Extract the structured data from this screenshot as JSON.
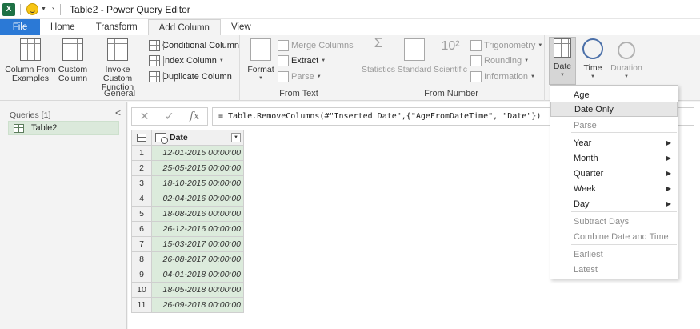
{
  "window": {
    "title": "Table2 - Power Query Editor",
    "app_logo": "X"
  },
  "tabs": [
    {
      "label": "File",
      "name": "tab-file"
    },
    {
      "label": "Home",
      "name": "tab-home"
    },
    {
      "label": "Transform",
      "name": "tab-transform"
    },
    {
      "label": "Add Column",
      "name": "tab-add-column"
    },
    {
      "label": "View",
      "name": "tab-view"
    }
  ],
  "ribbon": {
    "general": {
      "label": "General",
      "column_from_examples": "Column From Examples",
      "custom_column": "Custom Column",
      "invoke_custom_function": "Invoke Custom Function",
      "conditional_column": "Conditional Column",
      "index_column": "Index Column",
      "duplicate_column": "Duplicate Column"
    },
    "from_text": {
      "label": "From Text",
      "format": "Format",
      "merge_columns": "Merge Columns",
      "extract": "Extract",
      "parse": "Parse"
    },
    "from_number": {
      "label": "From Number",
      "statistics": "Statistics",
      "standard": "Standard",
      "scientific": "Scientific",
      "trigonometry": "Trigonometry",
      "rounding": "Rounding",
      "information": "Information"
    },
    "date_time": {
      "date": "Date",
      "time": "Time",
      "duration": "Duration"
    }
  },
  "queries": {
    "header": "Queries [1]",
    "items": [
      {
        "label": "Table2"
      }
    ]
  },
  "formula_bar": {
    "formula": "= Table.RemoveColumns(#\"Inserted Date\",{\"AgeFromDateTime\", \"Date\"})",
    "fx": "fx"
  },
  "table": {
    "column": "Date",
    "rows": [
      {
        "n": "1",
        "value": "12-01-2015 00:00:00"
      },
      {
        "n": "2",
        "value": "25-05-2015 00:00:00"
      },
      {
        "n": "3",
        "value": "18-10-2015 00:00:00"
      },
      {
        "n": "4",
        "value": "02-04-2016 00:00:00"
      },
      {
        "n": "5",
        "value": "18-08-2016 00:00:00"
      },
      {
        "n": "6",
        "value": "26-12-2016 00:00:00"
      },
      {
        "n": "7",
        "value": "15-03-2017 00:00:00"
      },
      {
        "n": "8",
        "value": "26-08-2017 00:00:00"
      },
      {
        "n": "9",
        "value": "04-01-2018 00:00:00"
      },
      {
        "n": "10",
        "value": "18-05-2018 00:00:00"
      },
      {
        "n": "11",
        "value": "26-09-2018 00:00:00"
      }
    ]
  },
  "date_menu": {
    "items": [
      {
        "label": "Age",
        "enabled": true,
        "submenu": false
      },
      {
        "label": "Date Only",
        "enabled": true,
        "submenu": false,
        "highlighted": true
      },
      {
        "label": "Parse",
        "enabled": false,
        "submenu": false
      },
      {
        "label": "Year",
        "enabled": true,
        "submenu": true
      },
      {
        "label": "Month",
        "enabled": true,
        "submenu": true
      },
      {
        "label": "Quarter",
        "enabled": true,
        "submenu": true
      },
      {
        "label": "Week",
        "enabled": true,
        "submenu": true
      },
      {
        "label": "Day",
        "enabled": true,
        "submenu": true
      },
      {
        "label": "Subtract Days",
        "enabled": false,
        "submenu": false
      },
      {
        "label": "Combine Date and Time",
        "enabled": false,
        "submenu": false
      },
      {
        "label": "Earliest",
        "enabled": false,
        "submenu": false
      },
      {
        "label": "Latest",
        "enabled": false,
        "submenu": false
      }
    ]
  },
  "colors": {
    "file_tab": "#2b79d6",
    "excel_green": "#1e7145",
    "selection_green": "#dcebdc"
  }
}
